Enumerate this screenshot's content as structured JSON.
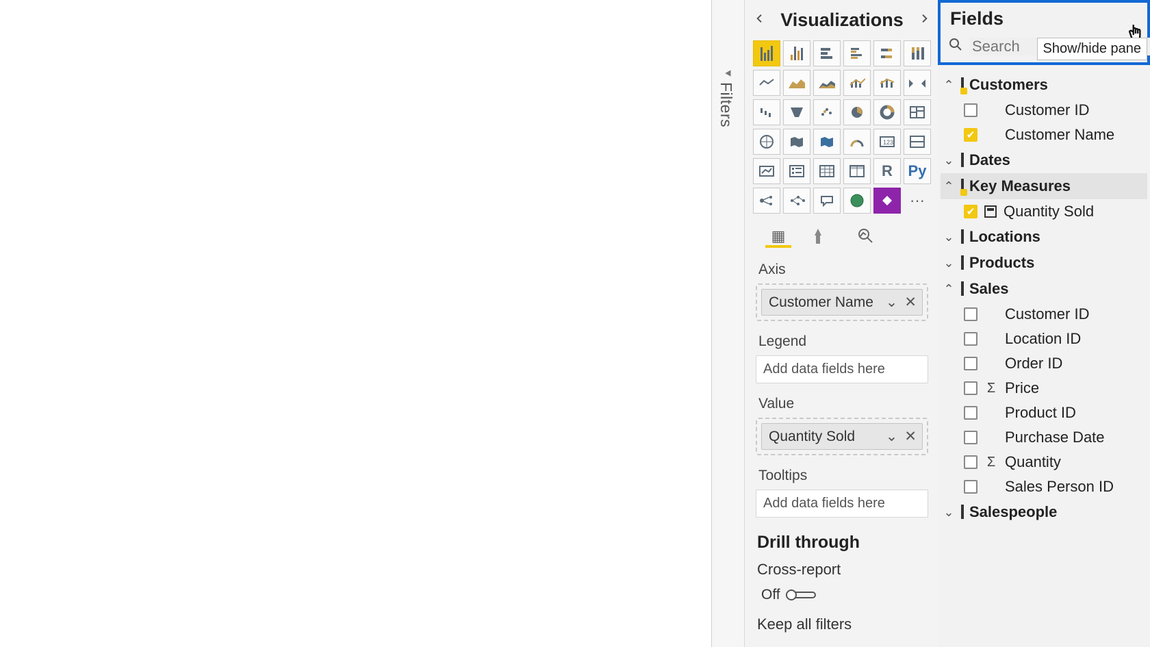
{
  "filters": {
    "title": "Filters"
  },
  "viz": {
    "title": "Visualizations",
    "r_label": "R",
    "py_label": "Py",
    "more_label": "···",
    "wells": {
      "axis": {
        "label": "Axis",
        "chip": "Customer Name"
      },
      "legend": {
        "label": "Legend",
        "placeholder": "Add data fields here"
      },
      "value": {
        "label": "Value",
        "chip": "Quantity Sold"
      },
      "tooltips": {
        "label": "Tooltips",
        "placeholder": "Add data fields here"
      }
    },
    "drill": {
      "title": "Drill through",
      "cross_report_label": "Cross-report",
      "toggle_state": "Off",
      "keep_all_filters": "Keep all filters"
    }
  },
  "fields": {
    "title": "Fields",
    "search_placeholder": "Search",
    "tooltip": "Show/hide pane",
    "tables": {
      "customers": {
        "label": "Customers",
        "fields": [
          {
            "label": "Customer ID",
            "checked": false
          },
          {
            "label": "Customer Name",
            "checked": true
          }
        ]
      },
      "dates": {
        "label": "Dates"
      },
      "key_measures": {
        "label": "Key Measures",
        "fields": [
          {
            "label": "Quantity Sold",
            "checked": true,
            "type": "measure"
          }
        ]
      },
      "locations": {
        "label": "Locations"
      },
      "products": {
        "label": "Products"
      },
      "sales": {
        "label": "Sales",
        "fields": [
          {
            "label": "Customer ID",
            "checked": false
          },
          {
            "label": "Location ID",
            "checked": false
          },
          {
            "label": "Order ID",
            "checked": false
          },
          {
            "label": "Price",
            "checked": false,
            "type": "sum"
          },
          {
            "label": "Product ID",
            "checked": false
          },
          {
            "label": "Purchase Date",
            "checked": false
          },
          {
            "label": "Quantity",
            "checked": false,
            "type": "sum"
          },
          {
            "label": "Sales Person ID",
            "checked": false
          }
        ]
      },
      "salespeople": {
        "label": "Salespeople"
      }
    }
  }
}
